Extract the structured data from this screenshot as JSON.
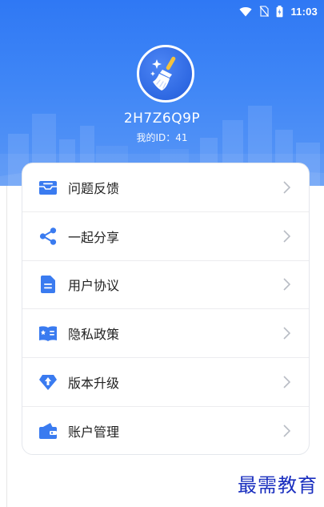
{
  "status_bar": {
    "time": "11:03",
    "icons": [
      "wifi-icon",
      "no-sim-icon",
      "battery-icon"
    ]
  },
  "profile": {
    "avatar_icon": "broom-sparkle-icon",
    "username": "2H7Z6Q9P",
    "id_label": "我的ID：",
    "id_value": "41"
  },
  "menu": {
    "items": [
      {
        "label": "问题反馈",
        "icon": "feedback-mail-icon"
      },
      {
        "label": "一起分享",
        "icon": "share-icon"
      },
      {
        "label": "用户协议",
        "icon": "document-icon"
      },
      {
        "label": "隐私政策",
        "icon": "privacy-book-icon"
      },
      {
        "label": "版本升级",
        "icon": "upgrade-diamond-icon"
      },
      {
        "label": "账户管理",
        "icon": "wallet-icon"
      }
    ]
  },
  "watermark": "最需教育",
  "colors": {
    "header_blue": "#2f78f4",
    "icon_blue": "#3a7bf0",
    "watermark_blue": "#1a2fbf",
    "chevron_gray": "#b8bcc4"
  }
}
